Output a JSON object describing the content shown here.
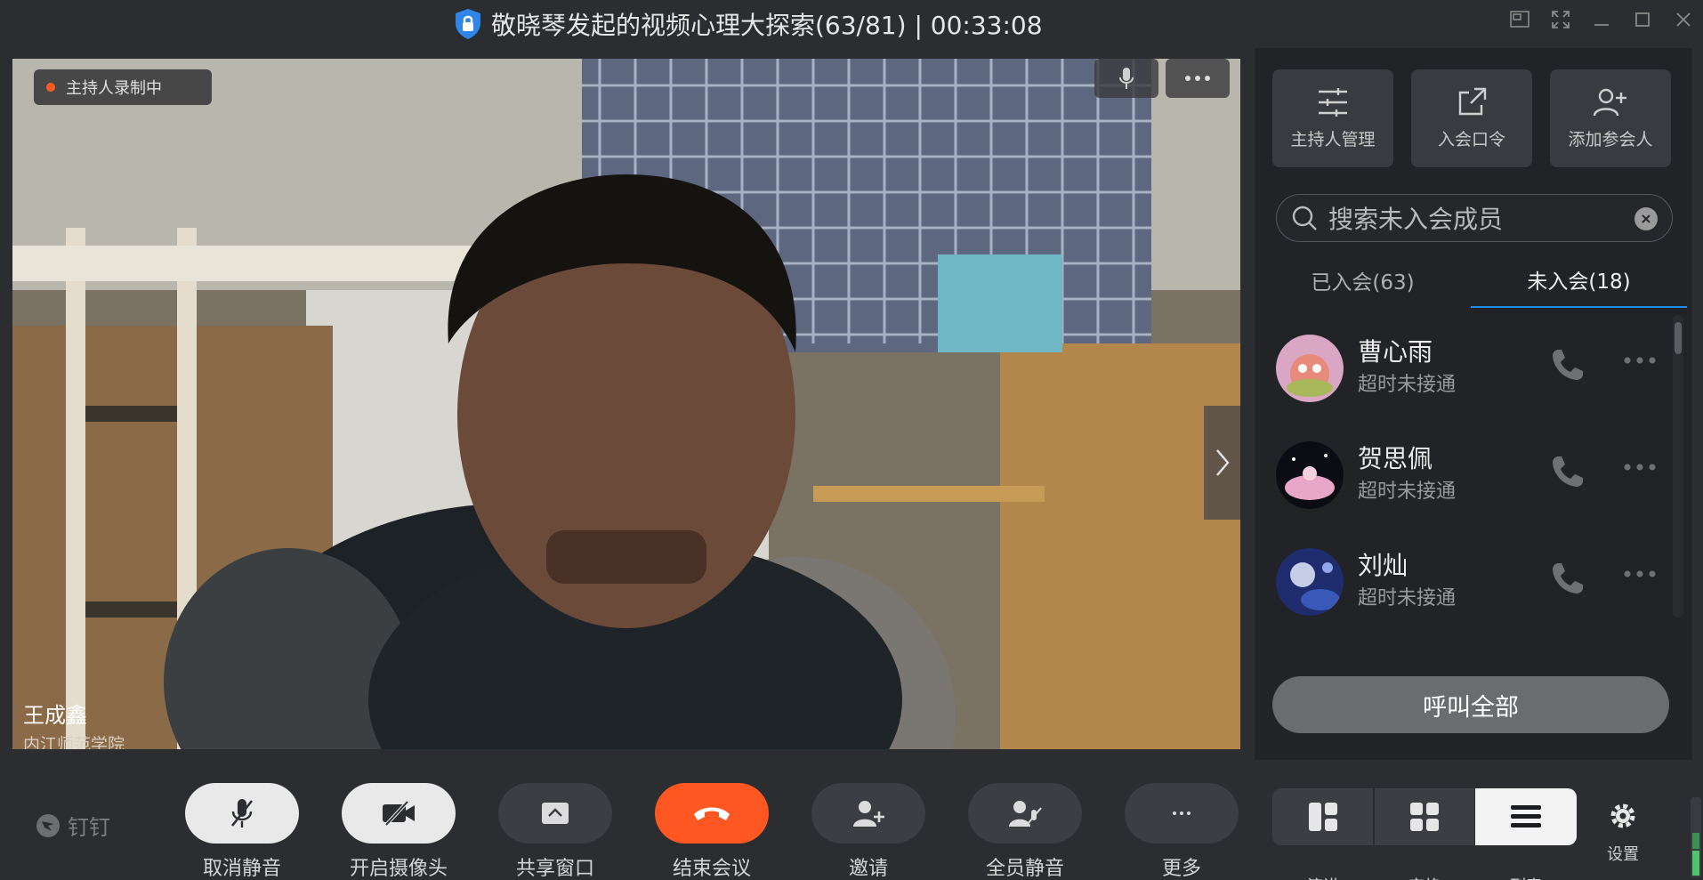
{
  "window": {
    "title": "敬晓琴发起的视频心理大探索(63/81) | 00:33:08"
  },
  "video": {
    "recording_badge": "主持人录制中",
    "speaker_name": "王成鑫",
    "speaker_org": "内江师范学院"
  },
  "panel": {
    "actions": [
      {
        "label": "主持人管理",
        "icon": "sliders-icon"
      },
      {
        "label": "入会口令",
        "icon": "share-link-icon"
      },
      {
        "label": "添加参会人",
        "icon": "add-user-icon"
      }
    ],
    "search_placeholder": "搜索未入会成员",
    "tabs": [
      {
        "label": "已入会(63)",
        "active": false
      },
      {
        "label": "未入会(18)",
        "active": true
      }
    ],
    "members": [
      {
        "name": "曹心雨",
        "status": "超时未接通"
      },
      {
        "name": "贺思佩",
        "status": "超时未接通"
      },
      {
        "name": "刘灿",
        "status": "超时未接通"
      }
    ],
    "call_all_label": "呼叫全部"
  },
  "toolbar": {
    "logo_text": "钉钉",
    "buttons": [
      {
        "label": "取消静音",
        "icon": "mic-muted-icon"
      },
      {
        "label": "开启摄像头",
        "icon": "camera-off-icon"
      },
      {
        "label": "共享窗口",
        "icon": "share-window-icon"
      },
      {
        "label": "结束会议",
        "icon": "hangup-icon"
      },
      {
        "label": "邀请",
        "icon": "invite-icon"
      },
      {
        "label": "全员静音",
        "icon": "mute-all-icon"
      },
      {
        "label": "更多",
        "icon": "more-icon"
      }
    ],
    "views": [
      {
        "label": "演讲",
        "icon": "speaker-layout-icon",
        "active": false
      },
      {
        "label": "宫格",
        "icon": "grid-layout-icon",
        "active": false
      },
      {
        "label": "列表",
        "icon": "list-layout-icon",
        "active": true
      }
    ],
    "settings_label": "设置"
  },
  "colors": {
    "accent_blue": "#1e8bf0",
    "end_call_red": "#ff5722",
    "recording_dot": "#ff5a1f"
  }
}
